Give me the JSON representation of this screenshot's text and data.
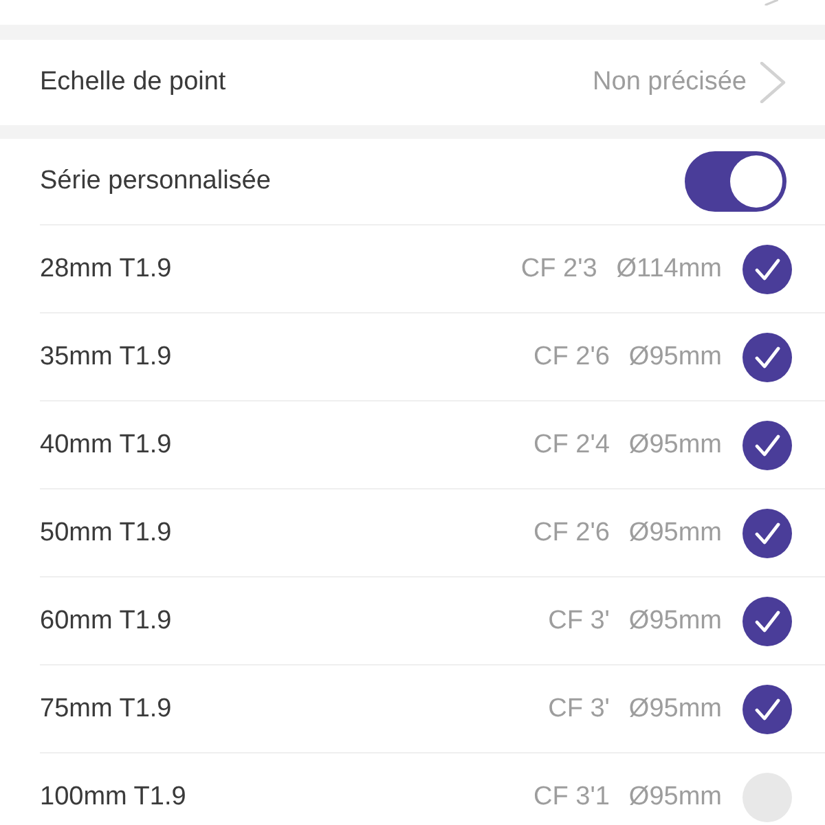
{
  "point_scale": {
    "label": "Echelle de point",
    "value": "Non précisée"
  },
  "custom_series": {
    "label": "Série personnalisée",
    "on": true
  },
  "lenses": [
    {
      "name": "28mm T1.9",
      "close_focus": "CF 2'3",
      "diameter": "Ø114mm",
      "checked": true
    },
    {
      "name": "35mm T1.9",
      "close_focus": "CF 2'6",
      "diameter": "Ø95mm",
      "checked": true
    },
    {
      "name": "40mm T1.9",
      "close_focus": "CF 2'4",
      "diameter": "Ø95mm",
      "checked": true
    },
    {
      "name": "50mm T1.9",
      "close_focus": "CF 2'6",
      "diameter": "Ø95mm",
      "checked": true
    },
    {
      "name": "60mm T1.9",
      "close_focus": "CF 3'",
      "diameter": "Ø95mm",
      "checked": true
    },
    {
      "name": "75mm T1.9",
      "close_focus": "CF 3'",
      "diameter": "Ø95mm",
      "checked": true
    },
    {
      "name": "100mm T1.9",
      "close_focus": "CF 3'1",
      "diameter": "Ø95mm",
      "checked": false
    }
  ]
}
